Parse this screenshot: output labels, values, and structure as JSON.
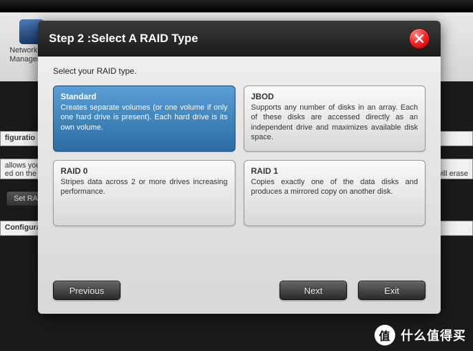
{
  "background": {
    "icon_label_line1": "Network",
    "icon_label_line2": "Management",
    "section1_title": "figuratio",
    "section1_text1": "allows you",
    "section1_text2": "ed on the h",
    "section1_text_right": "will erase",
    "button_label": "Set RA",
    "section2_title": "Configurat"
  },
  "modal": {
    "title": "Step 2 :Select A RAID Type",
    "prompt": "Select your RAID type.",
    "options": [
      {
        "title": "Standard",
        "desc": "Creates separate volumes (or one volume if only one hard drive is present). Each hard drive is its own volume.",
        "selected": true
      },
      {
        "title": "JBOD",
        "desc": "Supports any number of disks in an array. Each of these disks are accessed directly as an independent drive and maximizes available disk space.",
        "selected": false
      },
      {
        "title": "RAID 0",
        "desc": "Stripes data across 2 or more drives increasing performance.",
        "selected": false
      },
      {
        "title": "RAID 1",
        "desc": "Copies exactly one of the data disks and produces a mirrored copy on another disk.",
        "selected": false
      }
    ],
    "buttons": {
      "previous": "Previous",
      "next": "Next",
      "exit": "Exit"
    }
  },
  "watermark": {
    "badge": "值",
    "text": "什么值得买"
  }
}
